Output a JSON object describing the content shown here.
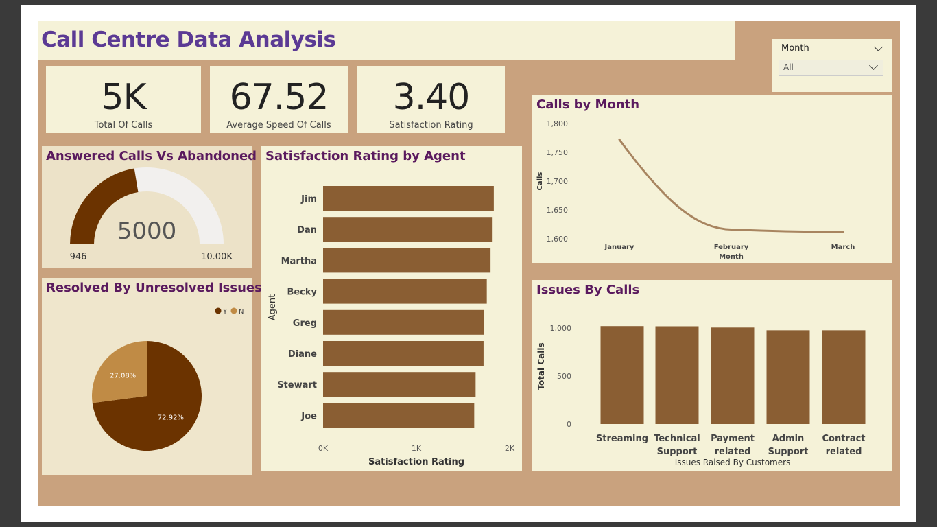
{
  "dashboard": {
    "title": "Call Centre Data Analysis"
  },
  "slicer": {
    "label": "Month",
    "selected": "All"
  },
  "kpis": [
    {
      "value": "5K",
      "label": "Total Of Calls"
    },
    {
      "value": "67.52",
      "label": "Average Speed Of Calls"
    },
    {
      "value": "3.40",
      "label": "Satisfaction Rating"
    }
  ],
  "gauge": {
    "title": "Answered Calls Vs Abandoned",
    "value_label": "5000",
    "min_label": "946",
    "max_label": "10.00K"
  },
  "pie": {
    "title": "Resolved By Unresolved Issues",
    "legend": [
      {
        "label": "Y",
        "color": "#6b3300"
      },
      {
        "label": "N",
        "color": "#c08b45"
      }
    ]
  },
  "bar_agent": {
    "title": "Satisfaction Rating by Agent"
  },
  "line_month": {
    "title": "Calls by Month"
  },
  "issues": {
    "title": "Issues By Calls"
  },
  "colors": {
    "canvas": "#c9a27e",
    "panel": "#f5f2d8",
    "title_purple": "#5b3a94",
    "panel_title": "#5a1a5e",
    "bar_brown": "#8a5e33",
    "line_brown": "#a88560",
    "gauge_fill": "#6b3300",
    "gauge_rest": "#f2f0ee"
  },
  "chart_data": [
    {
      "type": "gauge",
      "title": "Answered Calls Vs Abandoned",
      "value": 5000,
      "min": 946,
      "max": 10000
    },
    {
      "type": "pie",
      "title": "Resolved By Unresolved Issues",
      "categories": [
        "Y",
        "N"
      ],
      "values": [
        72.92,
        27.08
      ],
      "value_labels": [
        "72.92%",
        "27.08%"
      ],
      "colors": [
        "#6b3300",
        "#c08b45"
      ],
      "legend": "top-right"
    },
    {
      "type": "bar",
      "orientation": "horizontal",
      "title": "Satisfaction Rating by Agent",
      "categories": [
        "Jim",
        "Dan",
        "Martha",
        "Becky",
        "Greg",
        "Diane",
        "Stewart",
        "Joe"
      ],
      "values": [
        1830,
        1810,
        1795,
        1755,
        1725,
        1720,
        1635,
        1620
      ],
      "xlabel": "Satisfaction Rating",
      "ylabel": "Agent",
      "xlim": [
        0,
        2000
      ],
      "xticks": [
        0,
        1000,
        2000
      ],
      "xtick_labels": [
        "0K",
        "1K",
        "2K"
      ],
      "grid": false
    },
    {
      "type": "line",
      "title": "Calls by Month",
      "x": [
        "January",
        "February",
        "March"
      ],
      "y": [
        1772,
        1616,
        1612
      ],
      "xlabel": "Month",
      "ylabel": "Calls",
      "ylim": [
        1600,
        1800
      ],
      "yticks": [
        1600,
        1650,
        1700,
        1750,
        1800
      ],
      "ytick_labels": [
        "1,600",
        "1,650",
        "1,700",
        "1,750",
        "1,800"
      ],
      "grid": false
    },
    {
      "type": "bar",
      "orientation": "vertical",
      "title": "Issues By Calls",
      "categories": [
        "Streaming",
        "Technical Support",
        "Payment related",
        "Admin Support",
        "Contract related"
      ],
      "category_lines": [
        [
          "Streaming"
        ],
        [
          "Technical",
          "Support"
        ],
        [
          "Payment",
          "related"
        ],
        [
          "Admin",
          "Support"
        ],
        [
          "Contract",
          "related"
        ]
      ],
      "values": [
        1020,
        1018,
        1005,
        976,
        976
      ],
      "xlabel": "Issues Raised By Customers",
      "ylabel": "Total Calls",
      "ylim": [
        0,
        1000
      ],
      "yticks": [
        0,
        500,
        1000
      ],
      "ytick_labels": [
        "0",
        "500",
        "1,000"
      ],
      "grid": false
    }
  ]
}
